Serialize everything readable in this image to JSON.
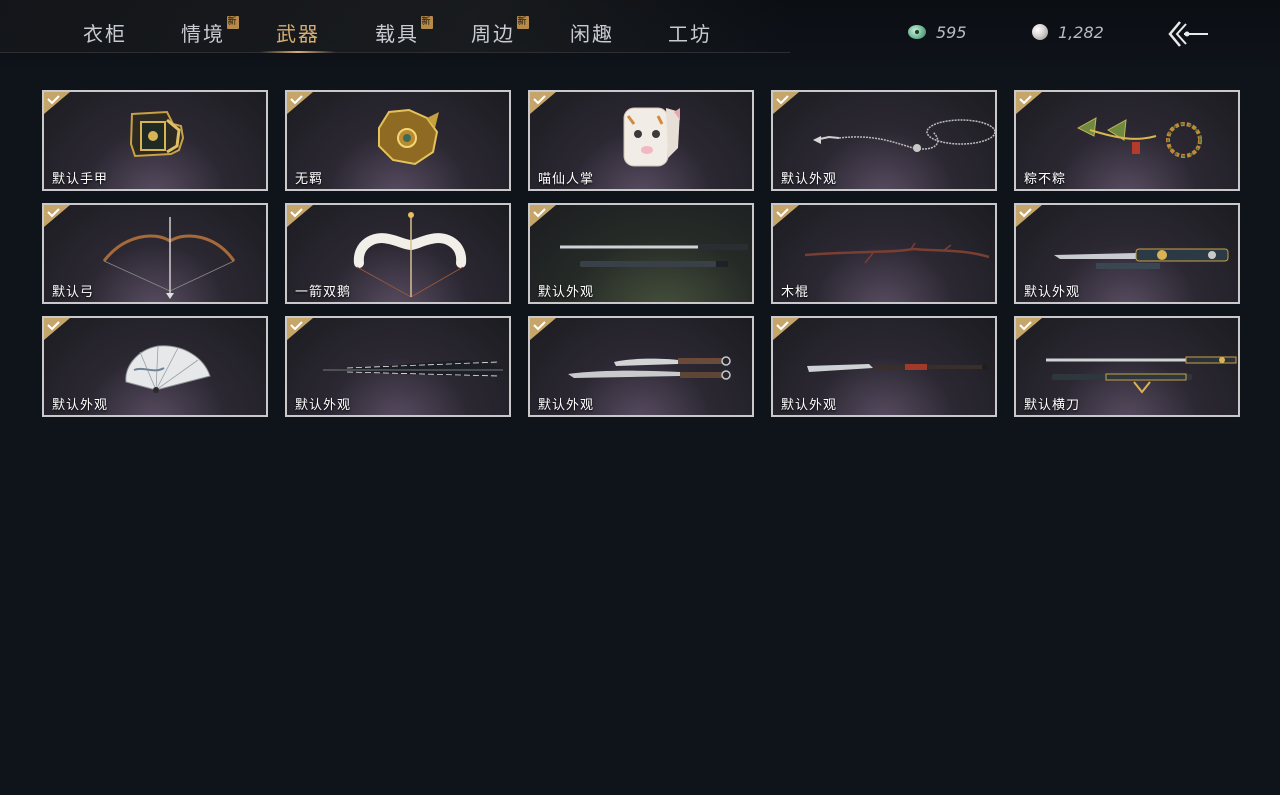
{
  "tabs": [
    {
      "label": "衣柜",
      "new": false,
      "active": false
    },
    {
      "label": "情境",
      "new": true,
      "active": false
    },
    {
      "label": "武器",
      "new": false,
      "active": true
    },
    {
      "label": "载具",
      "new": true,
      "active": false
    },
    {
      "label": "周边",
      "new": true,
      "active": false
    },
    {
      "label": "闲趣",
      "new": false,
      "active": false
    },
    {
      "label": "工坊",
      "new": false,
      "active": false
    }
  ],
  "new_badge": "新",
  "currency": {
    "jade": {
      "icon": "jade-coin-icon",
      "value": "595"
    },
    "pearl": {
      "icon": "pearl-icon",
      "value": "1,282"
    }
  },
  "items": [
    {
      "label": "默认手甲",
      "icon": "gauntlet-icon",
      "equipped": true
    },
    {
      "label": "无羁",
      "icon": "golden-gauntlet-icon",
      "equipped": true
    },
    {
      "label": "喵仙人掌",
      "icon": "cat-paw-icon",
      "equipped": true
    },
    {
      "label": "默认外观",
      "icon": "rope-dart-icon",
      "equipped": true
    },
    {
      "label": "粽不粽",
      "icon": "zongzi-rope-dart-icon",
      "equipped": true
    },
    {
      "label": "默认弓",
      "icon": "bow-icon",
      "equipped": true
    },
    {
      "label": "一箭双鹅",
      "icon": "goose-bow-icon",
      "equipped": true
    },
    {
      "label": "默认外观",
      "icon": "double-sword-icon",
      "equipped": true
    },
    {
      "label": "木棍",
      "icon": "wooden-staff-icon",
      "equipped": true
    },
    {
      "label": "默认外观",
      "icon": "ornate-sword-icon",
      "equipped": true
    },
    {
      "label": "默认外观",
      "icon": "folding-fan-icon",
      "equipped": true
    },
    {
      "label": "默认外观",
      "icon": "umbrella-icon",
      "equipped": true
    },
    {
      "label": "默认外观",
      "icon": "dual-blades-icon",
      "equipped": true
    },
    {
      "label": "默认外观",
      "icon": "glaive-icon",
      "equipped": true
    },
    {
      "label": "默认横刀",
      "icon": "hengdao-icon",
      "equipped": true
    }
  ],
  "colors": {
    "accent": "#d7ad74",
    "background": "#0f131a",
    "card_border": "#c9c9cb"
  }
}
